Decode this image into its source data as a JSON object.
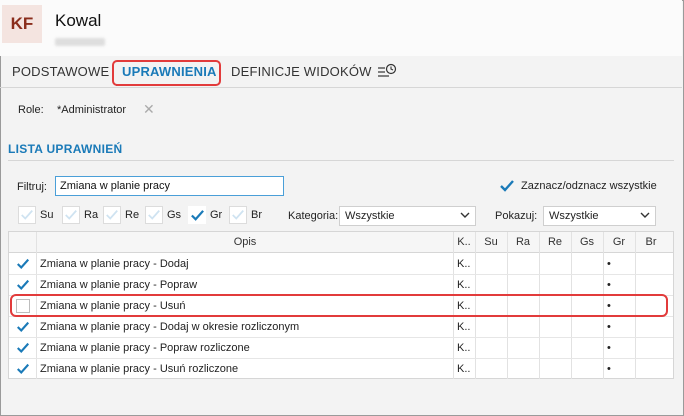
{
  "header": {
    "initials": "KF",
    "title": "Kowal"
  },
  "tabs": [
    {
      "label": "PODSTAWOWE",
      "active": false
    },
    {
      "label": "UPRAWNIENIA",
      "active": true
    },
    {
      "label": "DEFINICJE WIDOKÓW",
      "active": false
    }
  ],
  "role": {
    "label": "Role:",
    "value": "*Administrator",
    "remove_glyph": "✕"
  },
  "section_title": "LISTA UPRAWNIEŃ",
  "filter": {
    "label": "Filtruj:",
    "value": "Zmiana w planie pracy"
  },
  "select_all": {
    "label": "Zaznacz/odznacz wszystkie",
    "checked": true
  },
  "flags": [
    {
      "label": "Su",
      "checked": false
    },
    {
      "label": "Ra",
      "checked": false
    },
    {
      "label": "Re",
      "checked": false
    },
    {
      "label": "Gs",
      "checked": false
    },
    {
      "label": "Gr",
      "checked": true
    },
    {
      "label": "Br",
      "checked": false
    }
  ],
  "category": {
    "label": "Kategoria:",
    "value": "Wszystkie"
  },
  "show": {
    "label": "Pokazuj:",
    "value": "Wszystkie"
  },
  "table": {
    "columns": [
      "Opis",
      "K..",
      "Su",
      "Ra",
      "Re",
      "Gs",
      "Gr",
      "Br"
    ],
    "rows": [
      {
        "checked": true,
        "opis": "Zmiana w planie pracy - Dodaj",
        "k": "K..",
        "gr": "•"
      },
      {
        "checked": true,
        "opis": "Zmiana w planie pracy - Popraw",
        "k": "K..",
        "gr": "•"
      },
      {
        "checked": false,
        "opis": "Zmiana w planie pracy - Usuń",
        "k": "K..",
        "gr": "•"
      },
      {
        "checked": true,
        "opis": "Zmiana w planie pracy - Dodaj w okresie rozliczonym",
        "k": "K..",
        "gr": "•"
      },
      {
        "checked": true,
        "opis": "Zmiana w planie pracy - Popraw rozliczone",
        "k": "K..",
        "gr": "•"
      },
      {
        "checked": true,
        "opis": "Zmiana w planie pracy - Usuń rozliczone",
        "k": "K..",
        "gr": "•"
      }
    ]
  },
  "colors": {
    "accent": "#1a7ab8",
    "highlight": "#e23b3b",
    "check": "#1a7ab8"
  }
}
